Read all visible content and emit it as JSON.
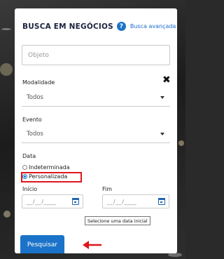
{
  "header": {
    "title": "BUSCA EM NEGÓCIOS",
    "help_glyph": "?",
    "advanced_link": "Busca avançada"
  },
  "objeto": {
    "placeholder": "Objeto",
    "value": ""
  },
  "close_glyph": "✖",
  "modalidade": {
    "label": "Modalidade",
    "selected": "Todos"
  },
  "evento": {
    "label": "Evento",
    "selected": "Todos"
  },
  "data": {
    "label": "Data",
    "options": [
      {
        "label": "Indeterminada",
        "checked": false
      },
      {
        "label": "Personalizada",
        "checked": true
      }
    ]
  },
  "inicio": {
    "label": "Início",
    "placeholder": "__/__/____"
  },
  "fim": {
    "label": "Fim",
    "placeholder": "__/__/____"
  },
  "tooltip": "Selecione uma data inicial",
  "submit_label": "Pesquisar",
  "colors": {
    "accent": "#1a73c8",
    "highlight": "#e0161e",
    "title": "#1a2340"
  }
}
